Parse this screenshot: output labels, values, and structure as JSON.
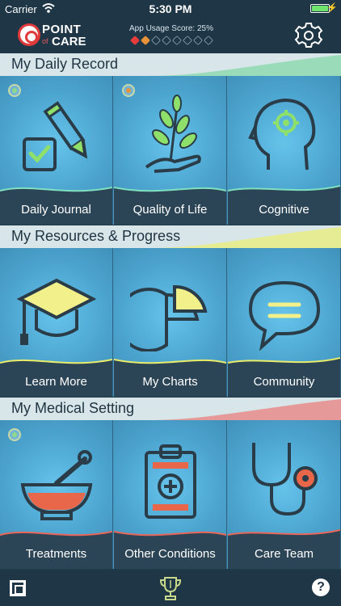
{
  "status_bar": {
    "carrier": "Carrier",
    "time": "5:30 PM"
  },
  "header": {
    "logo_point": "POINT",
    "logo_of": "of",
    "logo_care": "CARE",
    "usage_label": "App Usage Score: 25%",
    "usage_score_percent": 25
  },
  "sections": [
    {
      "title": "My Daily Record",
      "tiles": [
        {
          "label": "Daily Journal",
          "icon": "journal-pencil-icon"
        },
        {
          "label": "Quality of Life",
          "icon": "plant-hand-icon"
        },
        {
          "label": "Cognitive",
          "icon": "head-gear-icon"
        }
      ]
    },
    {
      "title": "My Resources & Progress",
      "tiles": [
        {
          "label": "Learn More",
          "icon": "graduation-cap-icon"
        },
        {
          "label": "My Charts",
          "icon": "pie-chart-icon"
        },
        {
          "label": "Community",
          "icon": "chat-bubble-icon"
        }
      ]
    },
    {
      "title": "My Medical Setting",
      "tiles": [
        {
          "label": "Treatments",
          "icon": "mortar-pestle-icon"
        },
        {
          "label": "Other Conditions",
          "icon": "clipboard-icon"
        },
        {
          "label": "Care Team",
          "icon": "stethoscope-icon"
        }
      ]
    }
  ],
  "bottom_bar": {
    "help": "?"
  },
  "colors": {
    "header_bg": "#1e3646",
    "tile_bg": "#4ca5cf",
    "label_band": "#2c4556",
    "accent_green": "#8fd98a",
    "accent_yellow": "#f2f08a",
    "accent_red": "#e85a4a",
    "accent_orange": "#e8933a"
  }
}
